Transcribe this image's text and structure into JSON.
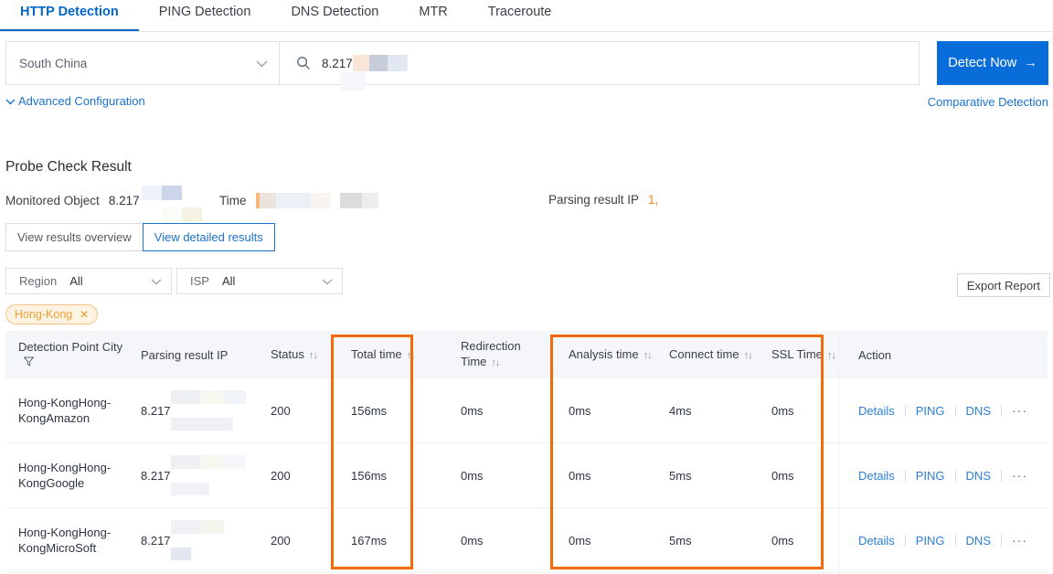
{
  "tabs": [
    {
      "label": "HTTP Detection",
      "active": true
    },
    {
      "label": "PING Detection",
      "active": false
    },
    {
      "label": "DNS Detection",
      "active": false
    },
    {
      "label": "MTR",
      "active": false
    },
    {
      "label": "Traceroute",
      "active": false
    }
  ],
  "query": {
    "region_value": "South China",
    "search_value": "8.217",
    "detect_button": "Detect Now",
    "detect_arrow": "→",
    "advanced_config": "Advanced Configuration",
    "comparative_detection": "Comparative Detection"
  },
  "probe": {
    "title": "Probe Check Result",
    "monitored_object_label": "Monitored Object",
    "monitored_object_value": "8.217",
    "time_label": "Time",
    "parsing_ip_label": "Parsing result IP",
    "parsing_ip_value": "1,"
  },
  "view_toggle": {
    "overview": "View results overview",
    "detailed": "View detailed results",
    "selected": "View detailed results"
  },
  "filters": {
    "region_label": "Region",
    "region_value": "All",
    "isp_label": "ISP",
    "isp_value": "All",
    "export_button": "Export Report",
    "tag": "Hong-Kong",
    "tag_close": "✕"
  },
  "table": {
    "columns": [
      {
        "id": "city",
        "label": "Detection Point City",
        "filterable": true,
        "sortable": false
      },
      {
        "id": "ip",
        "label": "Parsing result IP",
        "sortable": false
      },
      {
        "id": "status",
        "label": "Status",
        "sortable": true
      },
      {
        "id": "total",
        "label": "Total time",
        "sortable": true,
        "highlighted": true
      },
      {
        "id": "redirection",
        "label": "Redirection Time",
        "sortable": true
      },
      {
        "id": "analysis",
        "label": "Analysis time",
        "sortable": true,
        "highlighted": true
      },
      {
        "id": "connect",
        "label": "Connect time",
        "sortable": true,
        "highlighted": true
      },
      {
        "id": "ssl",
        "label": "SSL Time",
        "sortable": true,
        "highlighted": true
      },
      {
        "id": "action",
        "label": "Action",
        "sortable": false
      }
    ],
    "sort_glyph": "↑↓",
    "rows": [
      {
        "city": "Hong-KongHong-KongAmazon",
        "ip": "8.217",
        "status": "200",
        "total": "156ms",
        "redirection": "0ms",
        "analysis": "0ms",
        "connect": "4ms",
        "ssl": "0ms",
        "actions": [
          "Details",
          "PING",
          "DNS"
        ],
        "more": "···"
      },
      {
        "city": "Hong-KongHong-KongGoogle",
        "ip": "8.217",
        "status": "200",
        "total": "156ms",
        "redirection": "0ms",
        "analysis": "0ms",
        "connect": "5ms",
        "ssl": "0ms",
        "actions": [
          "Details",
          "PING",
          "DNS"
        ],
        "more": "···"
      },
      {
        "city": "Hong-KongHong-KongMicroSoft",
        "ip": "8.217",
        "status": "200",
        "total": "167ms",
        "redirection": "0ms",
        "analysis": "0ms",
        "connect": "5ms",
        "ssl": "0ms",
        "actions": [
          "Details",
          "PING",
          "DNS"
        ],
        "more": "···"
      }
    ]
  },
  "colors": {
    "accent_blue": "#096dd9",
    "link_blue": "#2b7fd6",
    "highlight_orange": "#f26a0a",
    "tag_orange": "#f0a033"
  }
}
